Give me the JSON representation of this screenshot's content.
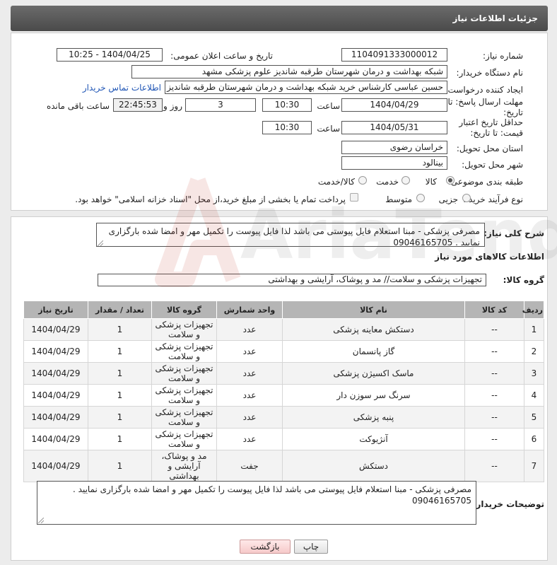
{
  "header": {
    "title": "جزئیات اطلاعات نیاز"
  },
  "form": {
    "need_number": {
      "label": "شماره نیاز:",
      "value": "1104091333000012"
    },
    "announce": {
      "label": "تاریخ و ساعت اعلان عمومی:",
      "value": "1404/04/25 - 10:25"
    },
    "buyer_org": {
      "label": "نام دستگاه خریدار:",
      "value": "شبکه بهداشت و درمان شهرستان طرقبه شاندیز   علوم پزشکی مشهد"
    },
    "requester": {
      "label": "ایجاد کننده درخواست:",
      "value": "حسین عباسی کارشناس خرید شبکه بهداشت و درمان شهرستان طرقبه شاندیز",
      "contact_link": "اطلاعات تماس خریدار"
    },
    "reply_deadline": {
      "label": "مهلت ارسال پاسخ: تا تاریخ:",
      "date": "1404/04/29",
      "time_label": "ساعت",
      "time": "10:30",
      "days": "3",
      "days_label": "روز و",
      "remaining": "22:45:53",
      "remaining_label": "ساعت باقی مانده"
    },
    "price_deadline": {
      "label": "حداقل تاریخ اعتبار قیمت: تا تاریخ:",
      "date": "1404/05/31",
      "time_label": "ساعت",
      "time": "10:30"
    },
    "province": {
      "label": "استان محل تحویل:",
      "value": "خراسان رضوی"
    },
    "city": {
      "label": "شهر محل تحویل:",
      "value": "بینالود"
    },
    "category": {
      "label": "طبقه بندی موضوعی:",
      "options": [
        "کالا",
        "خدمت",
        "کالا/خدمت"
      ],
      "selected": "کالا"
    },
    "purchase_type": {
      "label": "نوع فرآیند خرید :",
      "options": [
        "جزیی",
        "متوسط"
      ],
      "note": "پرداخت تمام یا بخشی از مبلغ خرید،از محل \"اسناد خزانه اسلامی\" خواهد بود."
    }
  },
  "summary": {
    "label": "شرح کلی نیاز:",
    "text": "مصرفی پزشکی - مبنا استعلام فایل پیوستی می باشد لذا فایل پیوست را تکمیل مهر و امضا شده بارگزاری نمایید . 09046165705"
  },
  "goods": {
    "section_title": "اطلاعات کالاهای مورد نیاز",
    "group_label": "گروه کالا:",
    "group_value": "تجهیزات پزشکی و سلامت// مد و پوشاک، آرایشی و بهداشتی",
    "columns": [
      "ردیف",
      "کد کالا",
      "نام کالا",
      "واحد شمارش",
      "گروه کالا",
      "تعداد / مقدار",
      "تاریخ نیاز"
    ],
    "rows": [
      {
        "row": "1",
        "code": "--",
        "name": "دستکش معاینه پزشکی",
        "unit": "عدد",
        "group": "تجهیزات پزشکی و سلامت",
        "qty": "1",
        "date": "1404/04/29"
      },
      {
        "row": "2",
        "code": "--",
        "name": "گاز پانسمان",
        "unit": "عدد",
        "group": "تجهیزات پزشکی و سلامت",
        "qty": "1",
        "date": "1404/04/29"
      },
      {
        "row": "3",
        "code": "--",
        "name": "ماسک اکسیژن پزشکی",
        "unit": "عدد",
        "group": "تجهیزات پزشکی و سلامت",
        "qty": "1",
        "date": "1404/04/29"
      },
      {
        "row": "4",
        "code": "--",
        "name": "سرنگ سر سوزن دار",
        "unit": "عدد",
        "group": "تجهیزات پزشکی و سلامت",
        "qty": "1",
        "date": "1404/04/29"
      },
      {
        "row": "5",
        "code": "--",
        "name": "پنبه پزشکی",
        "unit": "عدد",
        "group": "تجهیزات پزشکی و سلامت",
        "qty": "1",
        "date": "1404/04/29"
      },
      {
        "row": "6",
        "code": "--",
        "name": "آنژیوکت",
        "unit": "عدد",
        "group": "تجهیزات پزشکی و سلامت",
        "qty": "1",
        "date": "1404/04/29"
      },
      {
        "row": "7",
        "code": "--",
        "name": "دستکش",
        "unit": "جفت",
        "group": "مد و پوشاک، آرایشی و بهداشتی",
        "qty": "1",
        "date": "1404/04/29"
      }
    ]
  },
  "buyer_notes": {
    "label": "توضیحات خریدار:",
    "text": "مصرفی پزشکی - مبنا استعلام فایل پیوستی می باشد لذا فایل پیوست را تکمیل مهر و امضا شده بارگزاری نمایید . 09046165705"
  },
  "buttons": {
    "print": "چاپ",
    "back": "بازگشت"
  },
  "watermark": {
    "text": "AriaTender.neT"
  }
}
